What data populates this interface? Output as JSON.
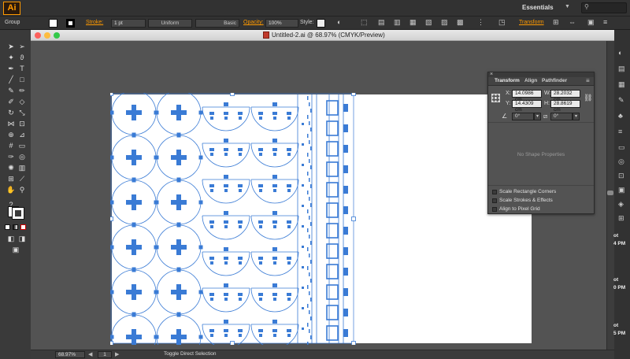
{
  "app": {
    "logo": "Ai",
    "workspace": "Essentials",
    "workspace_arrow": "▼",
    "search_icon": "search-icon"
  },
  "control_bar": {
    "selection_type": "Group",
    "stroke_label": "Stroke:",
    "stroke_weight": "1 pt",
    "profile_label": "Uniform",
    "brush_label": "Basic",
    "opacity_label": "Opacity:",
    "opacity_value": "100%",
    "style_label": "Style:",
    "transform_label": "Transform",
    "fill_color": "#ffffff",
    "stroke_color": "#000000"
  },
  "document": {
    "title": "Untitled-2.ai @ 68.97% (CMYK/Preview)",
    "artboard_color": "#ffffff",
    "art_color": "#3a7bd5"
  },
  "status_bar": {
    "zoom": "68.97%",
    "page": "1",
    "status_text": "Toggle Direct Selection"
  },
  "transform_panel": {
    "tabs": [
      {
        "label": "Transform",
        "active": true
      },
      {
        "label": "Align",
        "active": false
      },
      {
        "label": "Pathfinder",
        "active": false
      }
    ],
    "panel_close": "×",
    "panel_menu": "≡",
    "x_label": "X:",
    "x_value": "14.0986 cm",
    "y_label": "Y:",
    "y_value": "14.4309 cm",
    "w_label": "W:",
    "w_value": "28.2032 cm",
    "h_label": "H:",
    "h_value": "28.8619 cm",
    "rotate_value": "0°",
    "shear_value": "0°",
    "no_shape_properties": "No Shape Properties",
    "options": [
      "Scale Rectangle Corners",
      "Scale Strokes & Effects",
      "Align to Pixel Grid"
    ]
  },
  "right_edge_text": [
    "ot",
    "4 PM",
    "ot",
    "0 PM",
    "ot",
    "5 PM"
  ]
}
